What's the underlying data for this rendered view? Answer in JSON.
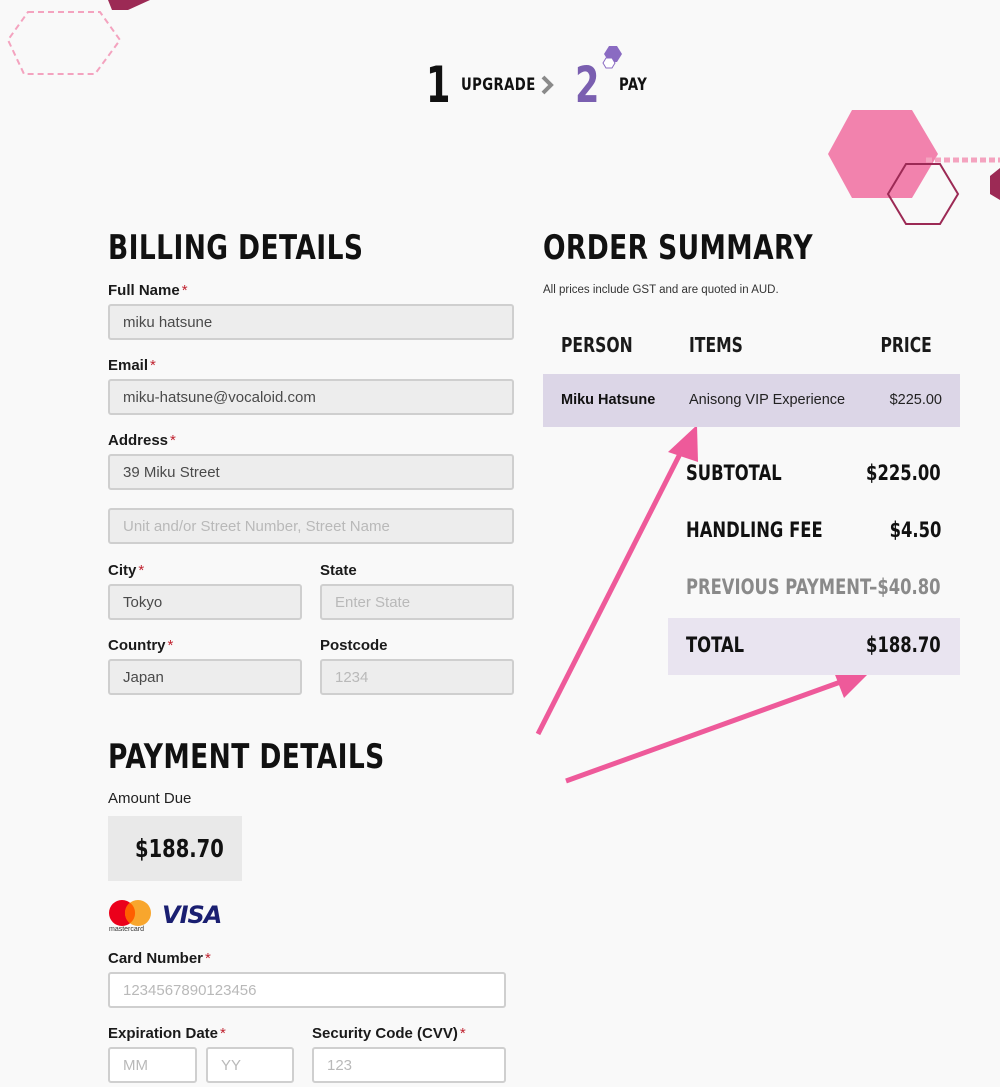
{
  "steps": [
    {
      "number": "1",
      "label": "UPGRADE"
    },
    {
      "number": "2",
      "label": "PAY"
    }
  ],
  "billing": {
    "heading": "BILLING DETAILS",
    "full_name": {
      "label": "Full Name",
      "value": "miku hatsune"
    },
    "email": {
      "label": "Email",
      "value": "miku-hatsune@vocaloid.com"
    },
    "address": {
      "label": "Address",
      "value": "39 Miku Street",
      "line2_placeholder": "Unit and/or Street Number, Street Name"
    },
    "city": {
      "label": "City",
      "value": "Tokyo"
    },
    "state": {
      "label": "State",
      "placeholder": "Enter State"
    },
    "country": {
      "label": "Country",
      "value": "Japan"
    },
    "postcode": {
      "label": "Postcode",
      "placeholder": "1234"
    }
  },
  "payment": {
    "heading": "PAYMENT DETAILS",
    "amount_due_label": "Amount Due",
    "amount_due": "$188.70",
    "mastercard_text": "mastercard",
    "visa_text": "VISA",
    "card_number": {
      "label": "Card Number",
      "placeholder": "1234567890123456"
    },
    "expiration": {
      "label": "Expiration Date",
      "mm_placeholder": "MM",
      "yy_placeholder": "YY"
    },
    "cvv": {
      "label": "Security Code (CVV)",
      "placeholder": "123"
    }
  },
  "summary": {
    "heading": "ORDER SUMMARY",
    "note": "All prices include GST and are quoted in AUD.",
    "columns": {
      "person": "PERSON",
      "items": "ITEMS",
      "price": "PRICE"
    },
    "rows": [
      {
        "person": "Miku Hatsune",
        "item": "Anisong VIP Experience",
        "price": "$225.00"
      }
    ],
    "subtotal": {
      "label": "SUBTOTAL",
      "value": "$225.00"
    },
    "handling_fee": {
      "label": "HANDLING FEE",
      "value": "$4.50"
    },
    "previous_payment": {
      "label": "PREVIOUS PAYMENT",
      "value": "–$40.80"
    },
    "total": {
      "label": "TOTAL",
      "value": "$188.70"
    }
  },
  "required_mark": "*",
  "colors": {
    "accent_purple": "#7a5fb0",
    "row_highlight": "#dcd6e7",
    "total_highlight": "#e9e4f0",
    "arrow_pink": "#ee5a9a",
    "hex_pink": "#f282ad",
    "hex_maroon": "#9c2a55"
  }
}
